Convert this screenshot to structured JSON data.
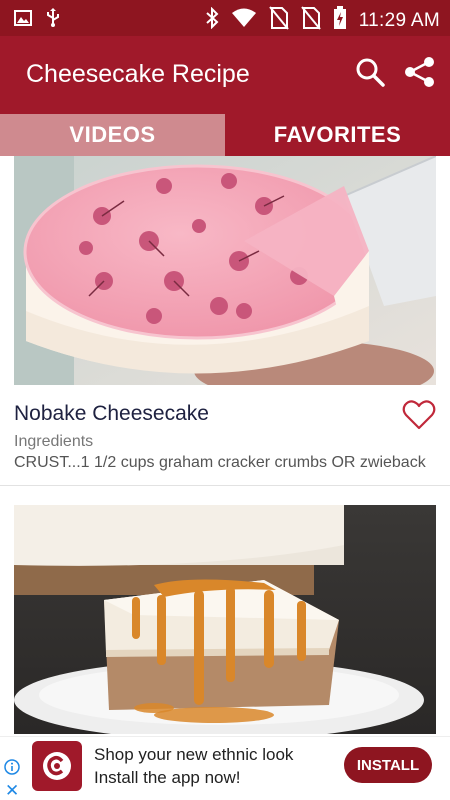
{
  "status_bar": {
    "time": "11:29 AM",
    "icons": [
      "image-icon",
      "usb-icon",
      "bluetooth-icon",
      "wifi-icon",
      "no-sim-icon",
      "no-sim-icon",
      "battery-charging-icon"
    ]
  },
  "app_bar": {
    "title": "Cheesecake Recipe",
    "actions": [
      "search-icon",
      "share-icon"
    ]
  },
  "tabs": [
    {
      "label": "VIDEOS",
      "selected": false
    },
    {
      "label": "FAVORITES",
      "selected": true
    }
  ],
  "recipes": [
    {
      "title": "Nobake Cheesecake",
      "subtitle": "Ingredients",
      "ingredients": "CRUST...1 1/2 cups graham cracker crumbs OR zwieback",
      "favorite_icon": "heart-outline-icon"
    },
    {
      "title": "",
      "subtitle": "",
      "ingredients": ""
    }
  ],
  "ad": {
    "line1": "Shop your new ethnic look",
    "line2": "Install the app now!",
    "button": "INSTALL",
    "icons": [
      "info-icon",
      "close-icon"
    ]
  },
  "colors": {
    "status_bar": "#8e1520",
    "app_bar": "#a0192a",
    "tab_inactive": "#cf8a8f",
    "tab_active": "#a0192a",
    "accent": "#c0283a"
  }
}
